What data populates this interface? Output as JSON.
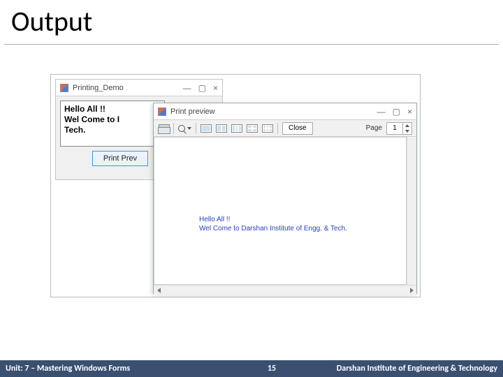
{
  "slide": {
    "title": "Output"
  },
  "window1": {
    "title": "Printing_Demo",
    "controls": {
      "min": "—",
      "max": "▢",
      "close": "×"
    },
    "textbox_visible": "Hello All !!\nWel Come to I\nTech.",
    "print_button_visible": "Print Prev"
  },
  "window2": {
    "title": "Print preview",
    "controls": {
      "min": "—",
      "max": "▢",
      "close": "×"
    },
    "toolbar": {
      "close_label": "Close",
      "page_label": "Page",
      "page_value": "1"
    },
    "preview_text": "Hello All !!\nWel Come to Darshan Institute of Engg. & Tech."
  },
  "footer": {
    "left": "Unit: 7 – Mastering Windows Forms",
    "center": "15",
    "right": "Darshan Institute of Engineering & Technology"
  }
}
